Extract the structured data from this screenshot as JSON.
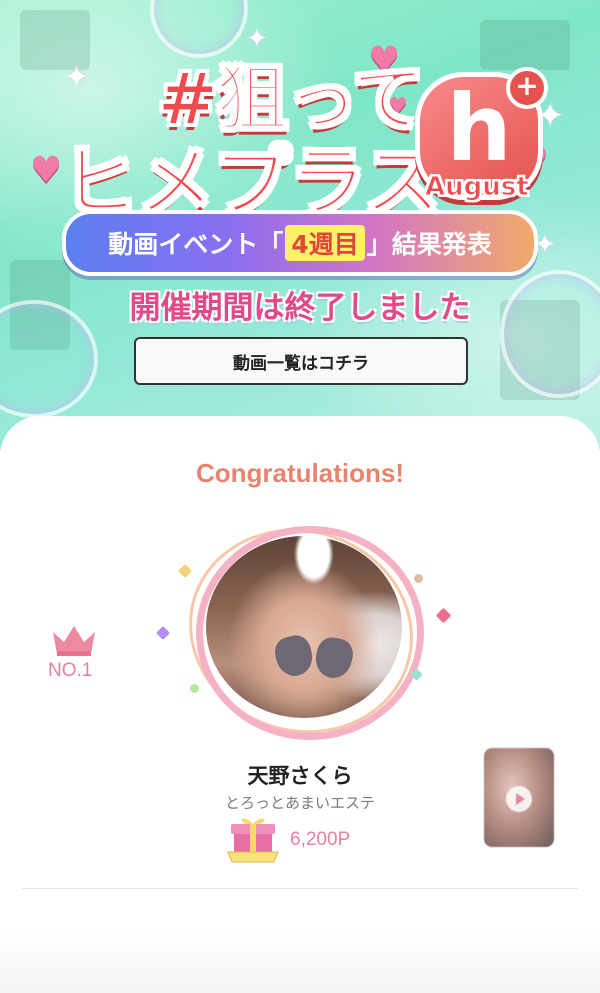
{
  "banner": {
    "title_line1": "#狙って",
    "title_line2": "ヒメプラス",
    "logo_letter": "h",
    "logo_plus": "+",
    "month": "August",
    "ribbon_prefix": "動画イベント「",
    "ribbon_week": "4週目",
    "ribbon_suffix": "」結果発表",
    "ended_text": "開催期間は終了しました",
    "video_list_button": "動画一覧はコチラ"
  },
  "result": {
    "congrats": "Congratulations!",
    "rank_label": "NO.1",
    "rank_icon": "crown-icon",
    "name": "天野さくら",
    "shop": "とろっとあまいエステ",
    "points": "6,200P",
    "gift_icon": "gift-badge-icon",
    "video_icon": "play-icon"
  },
  "colors": {
    "accent_pink": "#e9809a",
    "congrats": "#e8836e",
    "title_red": "#ef4b4f"
  }
}
